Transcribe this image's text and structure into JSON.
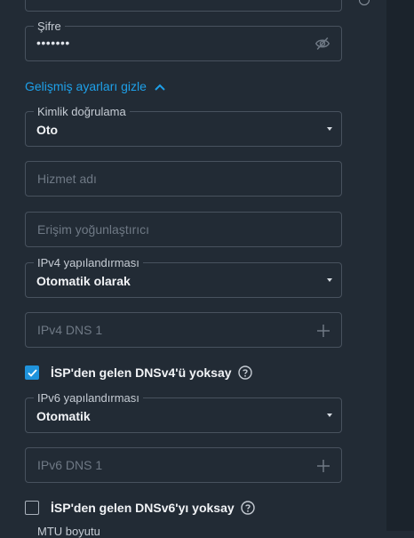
{
  "password": {
    "label": "Şifre",
    "value": "•••••••",
    "toggle_icon": "eye-off-icon"
  },
  "advanced_toggle": {
    "label": "Gelişmiş ayarları gizle",
    "icon": "chevron-up-icon"
  },
  "auth": {
    "label": "Kimlik doğrulama",
    "value": "Oto"
  },
  "service_name": {
    "placeholder": "Hizmet adı"
  },
  "access_concentrator": {
    "placeholder": "Erişim yoğunlaştırıcı"
  },
  "ipv4_config": {
    "label": "IPv4 yapılandırması",
    "value": "Otomatik olarak"
  },
  "ipv4_dns": {
    "placeholder": "IPv4 DNS 1",
    "icon": "plus-icon"
  },
  "ignore_dns4": {
    "label": "İSP'den gelen DNSv4'ü yoksay",
    "checked": true,
    "icon": "help-icon"
  },
  "ipv6_config": {
    "label": "IPv6 yapılandırması",
    "value": "Otomatik"
  },
  "ipv6_dns": {
    "placeholder": "IPv6 DNS 1",
    "icon": "plus-icon"
  },
  "ignore_dns6": {
    "label": "İSP'den gelen DNSv6'yı yoksay",
    "checked": false,
    "icon": "help-icon"
  },
  "mtu": {
    "label": "MTU boyutu"
  },
  "colors": {
    "background": "#222b35",
    "accent": "#1ea0e9",
    "border": "#48525e",
    "placeholder": "#6f7985"
  }
}
